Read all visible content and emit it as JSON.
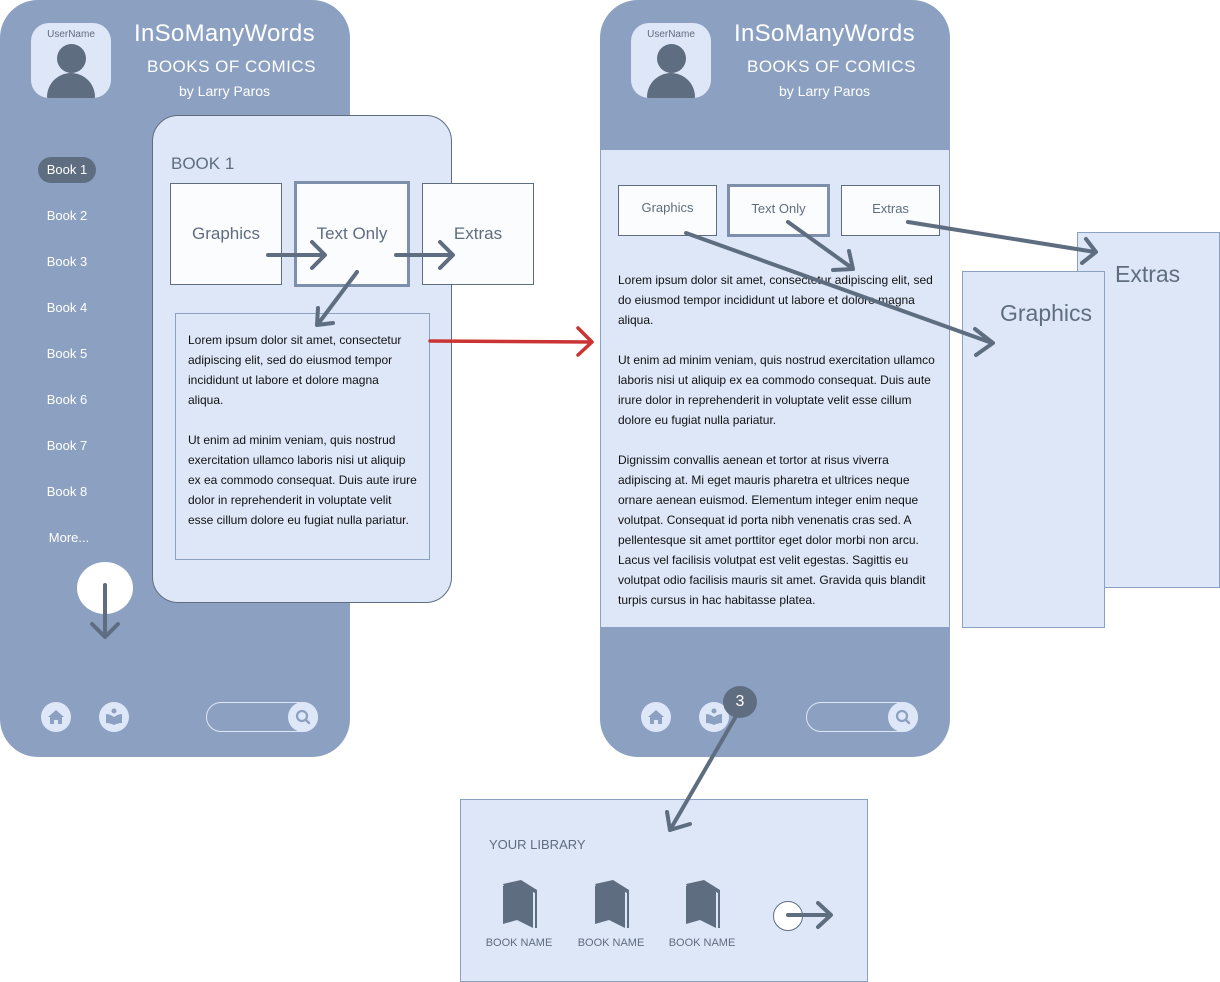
{
  "app": {
    "title": "InSoManyWords",
    "subtitle": "BOOKS OF COMICS",
    "author": "by Larry Paros",
    "username": "UserName"
  },
  "sidebar": {
    "items": [
      {
        "label": "Book 1",
        "active": true
      },
      {
        "label": "Book 2"
      },
      {
        "label": "Book 3"
      },
      {
        "label": "Book 4"
      },
      {
        "label": "Book 5"
      },
      {
        "label": "Book 6"
      },
      {
        "label": "Book 7"
      },
      {
        "label": "Book 8"
      },
      {
        "label": "More..."
      }
    ]
  },
  "bottom_bar": {
    "icons": [
      "home-icon",
      "reading-icon",
      "search-icon"
    ],
    "search_placeholder": "",
    "library_badge": "3"
  },
  "book_card": {
    "title": "BOOK 1",
    "options": [
      "Graphics",
      "Text Only",
      "Extras"
    ],
    "selected": "Text Only",
    "paragraphs": [
      "Lorem ipsum dolor sit amet, consectetur adipiscing elit, sed do eiusmod tempor incididunt ut labore et dolore magna aliqua.",
      "Ut enim ad minim veniam, quis nostrud exercitation ullamco laboris nisi ut aliquip ex ea commodo consequat. Duis aute irure dolor in reprehenderit in voluptate velit esse cillum dolore eu fugiat nulla pariatur."
    ]
  },
  "reader": {
    "options": [
      "Graphics",
      "Text Only",
      "Extras"
    ],
    "selected": "Text Only",
    "paragraphs": [
      "Lorem ipsum dolor sit amet, consectetur adipiscing elit, sed do eiusmod tempor incididunt ut labore et dolore magna aliqua.",
      "Ut enim ad minim veniam, quis nostrud exercitation ullamco laboris nisi ut aliquip ex ea commodo consequat. Duis aute irure dolor in reprehenderit in voluptate velit esse cillum dolore eu fugiat nulla pariatur.",
      "Dignissim convallis aenean et tortor at risus viverra adipiscing at. Mi eget mauris pharetra et ultrices neque ornare aenean euismod. Elementum integer enim neque volutpat. Consequat id porta nibh venenatis cras sed. A pellentesque sit amet porttitor eget dolor morbi non arcu. Lacus vel facilisis volutpat est velit egestas. Sagittis eu volutpat odio facilisis mauris sit amet. Gravida quis blandit turpis cursus in hac habitasse platea."
    ]
  },
  "panels": {
    "graphics_label": "Graphics",
    "extras_label": "Extras"
  },
  "library": {
    "title": "YOUR LIBRARY",
    "books": [
      {
        "name": "BOOK NAME"
      },
      {
        "name": "BOOK NAME"
      },
      {
        "name": "BOOK NAME"
      }
    ]
  },
  "colors": {
    "frame": "#8ca1c1",
    "surface": "#dee7f7",
    "ink": "#5f6d80",
    "accent_arrow": "#cc3333"
  }
}
